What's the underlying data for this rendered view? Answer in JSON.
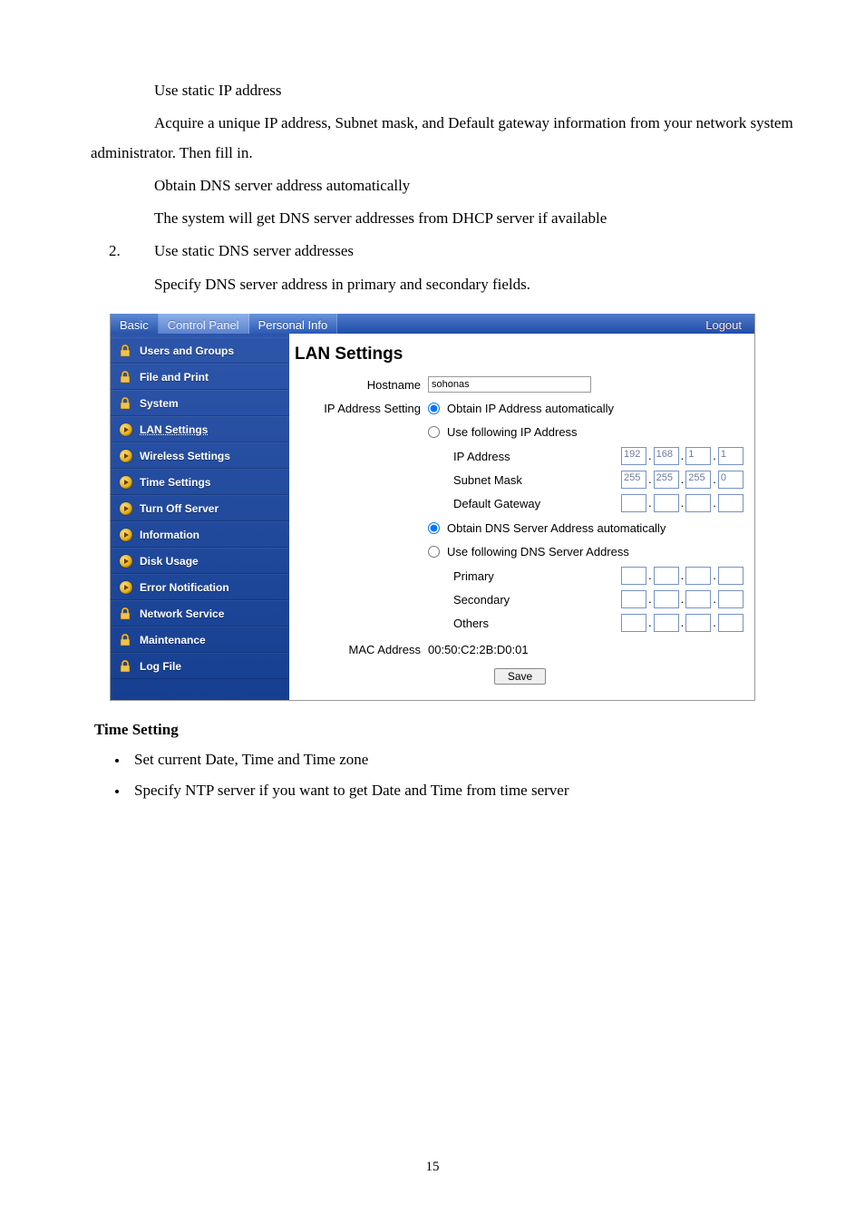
{
  "doc": {
    "p1": "Use static IP address",
    "p2": "Acquire a unique IP address, Subnet mask, and Default gateway information from your network system administrator. Then fill in.",
    "p3": "Obtain DNS server address automatically",
    "p4": "The system will get DNS server addresses from DHCP server if available",
    "num": "2.",
    "p5": "Use static DNS server addresses",
    "p6": "Specify DNS server address in primary and secondary fields."
  },
  "tabs": {
    "basic": "Basic",
    "control_panel": "Control Panel",
    "personal_info": "Personal Info",
    "logout": "Logout"
  },
  "sidebar": {
    "items": [
      {
        "label": "Users and Groups",
        "type": "cat"
      },
      {
        "label": "File and Print",
        "type": "cat"
      },
      {
        "label": "System",
        "type": "cat"
      },
      {
        "label": "LAN Settings",
        "type": "sub",
        "selected": true
      },
      {
        "label": "Wireless Settings",
        "type": "sub"
      },
      {
        "label": "Time Settings",
        "type": "sub"
      },
      {
        "label": "Turn Off Server",
        "type": "sub"
      },
      {
        "label": "Information",
        "type": "sub"
      },
      {
        "label": "Disk Usage",
        "type": "sub"
      },
      {
        "label": "Error Notification",
        "type": "sub"
      },
      {
        "label": "Network Service",
        "type": "cat"
      },
      {
        "label": "Maintenance",
        "type": "cat"
      },
      {
        "label": "Log File",
        "type": "cat"
      }
    ]
  },
  "lan": {
    "title": "LAN Settings",
    "hostname_label": "Hostname",
    "hostname_value": "sohonas",
    "ip_setting_label": "IP Address Setting",
    "ip_auto": "Obtain IP Address automatically",
    "ip_static": "Use following IP Address",
    "ip_address_label": "IP Address",
    "subnet_label": "Subnet Mask",
    "gateway_label": "Default Gateway",
    "ip": [
      "192",
      "168",
      "1",
      "1"
    ],
    "subnet": [
      "255",
      "255",
      "255",
      "0"
    ],
    "gateway": [
      "",
      "",
      "",
      ""
    ],
    "dns_auto": "Obtain DNS Server Address automatically",
    "dns_static": "Use following DNS Server Address",
    "primary_label": "Primary",
    "secondary_label": "Secondary",
    "others_label": "Others",
    "primary": [
      "",
      "",
      "",
      ""
    ],
    "secondary": [
      "",
      "",
      "",
      ""
    ],
    "others": [
      "",
      "",
      "",
      ""
    ],
    "mac_label": "MAC Address",
    "mac_value": "00:50:C2:2B:D0:01",
    "save": "Save"
  },
  "after": {
    "heading": "Time Setting",
    "b1": "Set current Date, Time and Time zone",
    "b2": "Specify NTP server if you want to get Date and Time from time server"
  },
  "page_number": "15"
}
